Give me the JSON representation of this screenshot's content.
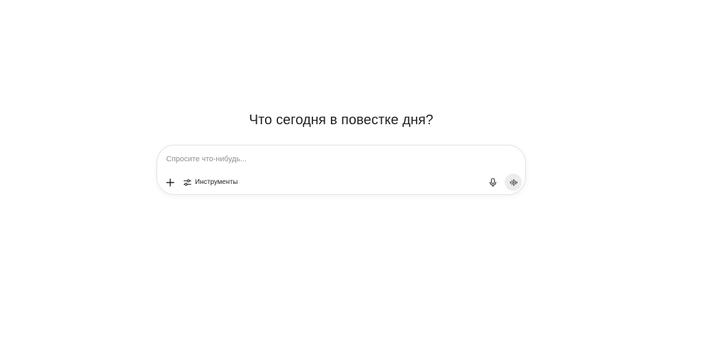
{
  "main": {
    "heading": "Что сегодня в повестке дня?"
  },
  "composer": {
    "placeholder": "Спросите что-нибудь...",
    "value": "",
    "tools_label": "Инструменты"
  },
  "icons": {
    "add": "plus-icon",
    "tools": "sliders-icon",
    "dictate": "microphone-icon",
    "voice": "voice-waveform-icon"
  }
}
